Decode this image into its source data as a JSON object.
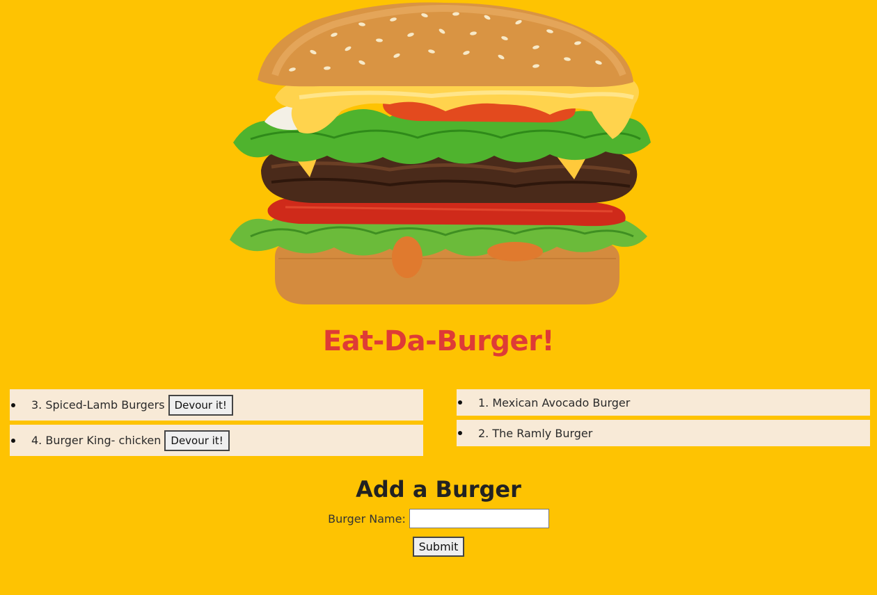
{
  "hero": {
    "image": "burger-photo",
    "colors": {
      "background": "#fec302",
      "bun": "#d58f3f",
      "cheese": "#ffd24a",
      "lettuce": "#4caf2f",
      "patty": "#4a2a1a",
      "tomato": "#d8301e"
    }
  },
  "header": {
    "title": "Eat-Da-Burger!",
    "title_color": "#de3b36"
  },
  "uneaten": [
    {
      "label": "3. Spiced-Lamb Burgers",
      "button": "Devour it!"
    },
    {
      "label": "4. Burger King- chicken",
      "button": "Devour it!"
    }
  ],
  "devoured": [
    {
      "label": "1. Mexican Avocado Burger"
    },
    {
      "label": "2. The Ramly Burger"
    }
  ],
  "form": {
    "heading": "Add a Burger",
    "name_label": "Burger Name:",
    "name_value": "",
    "submit_label": "Submit"
  }
}
